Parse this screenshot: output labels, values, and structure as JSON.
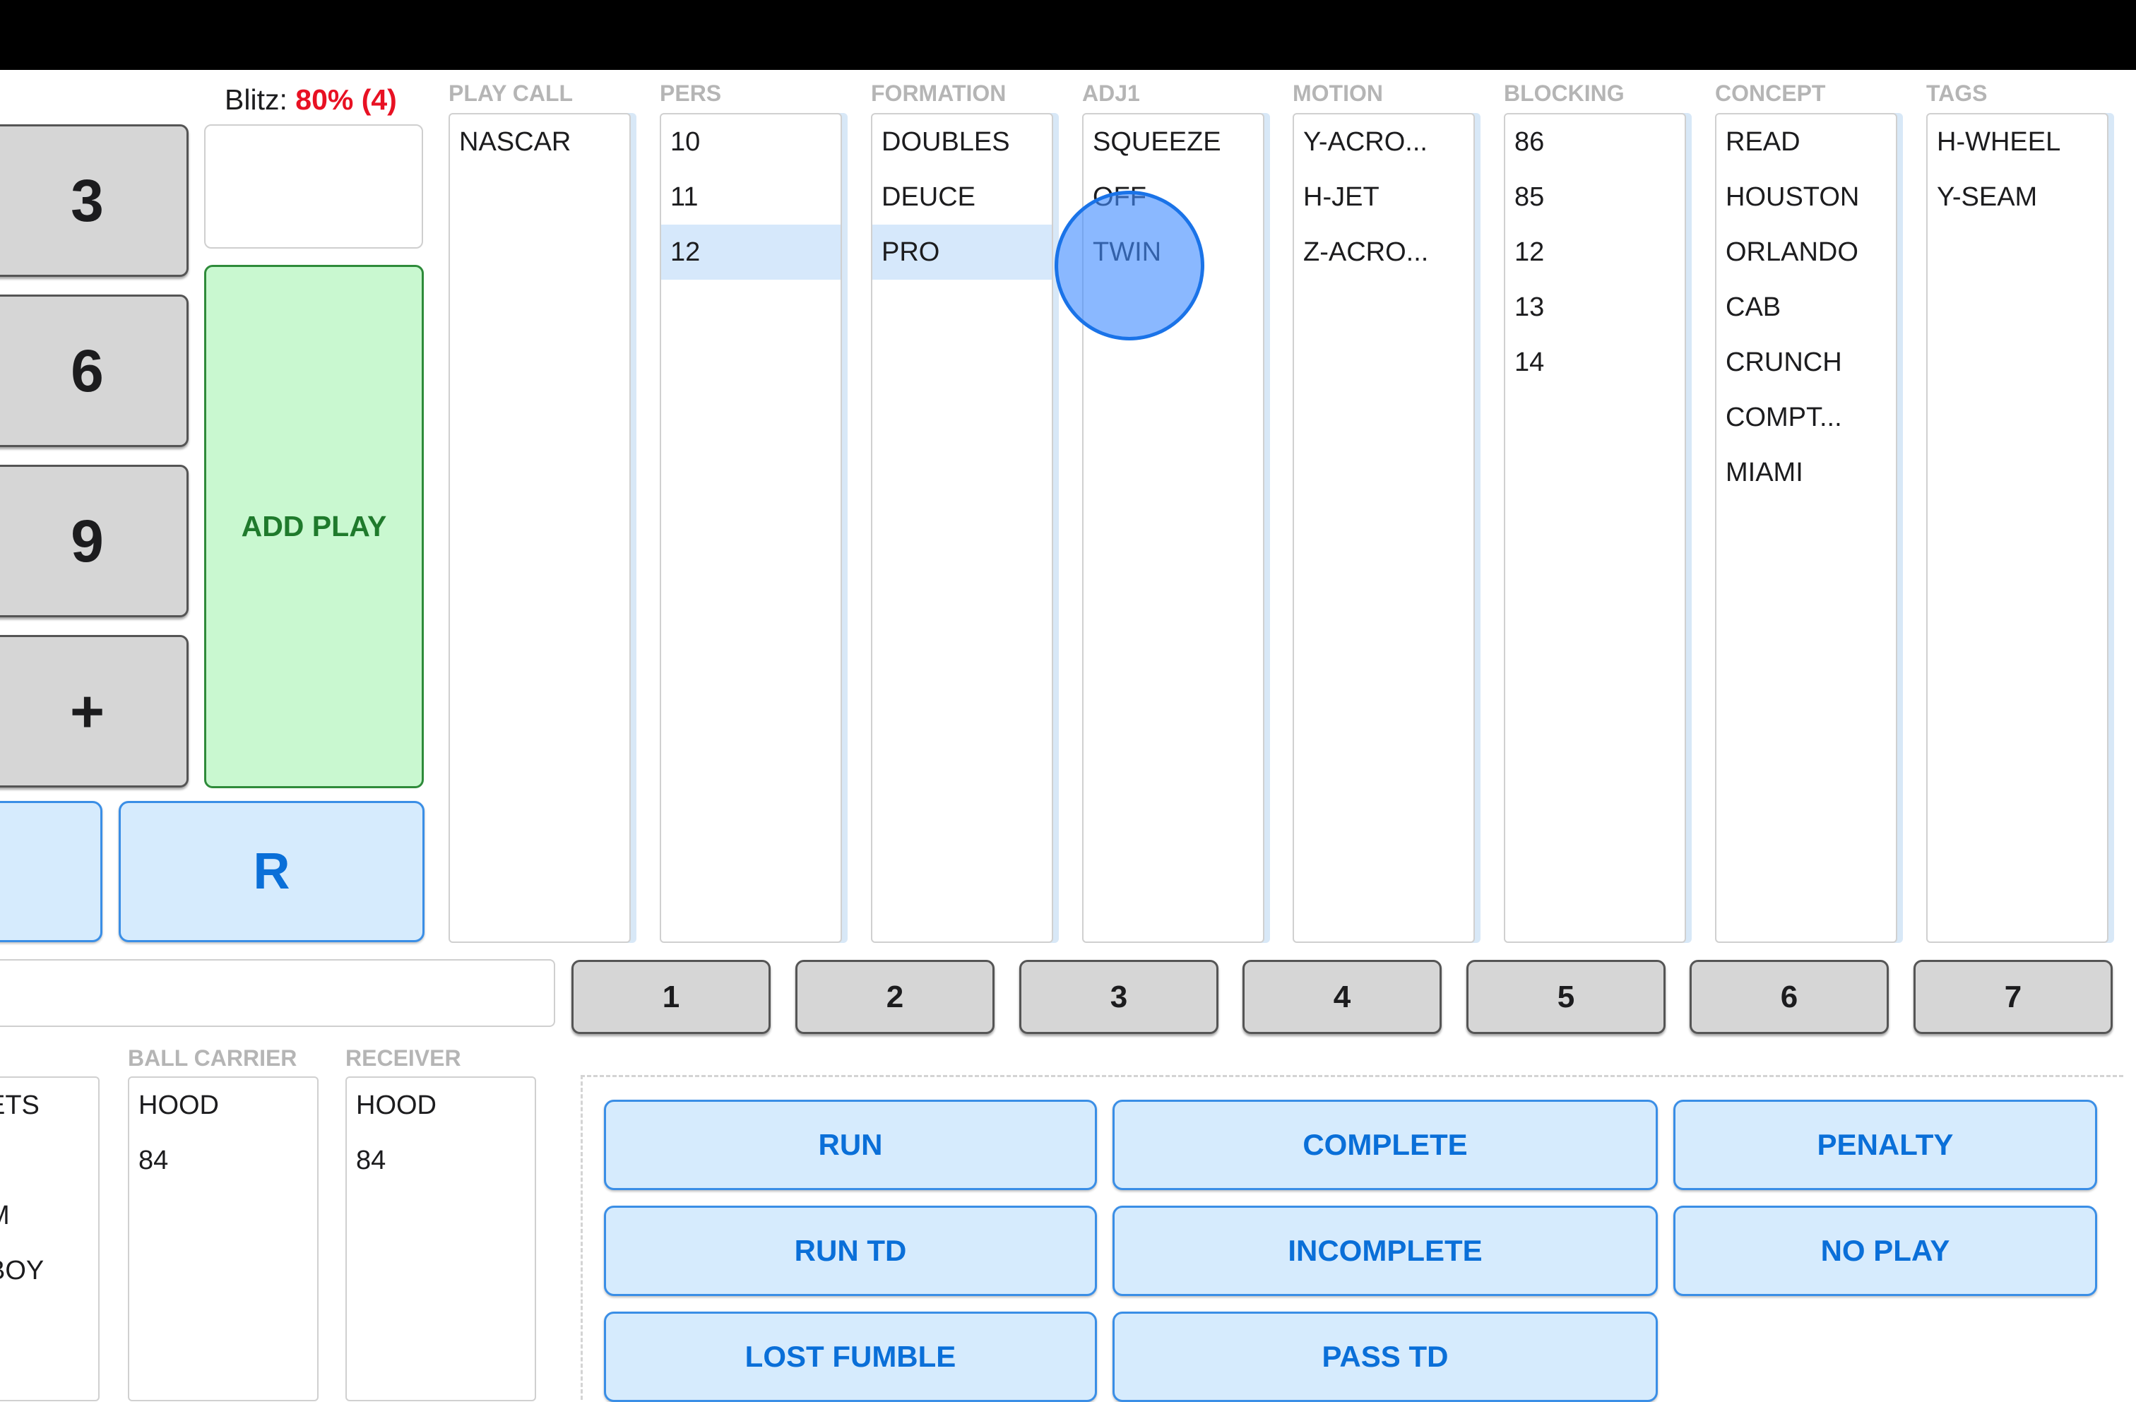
{
  "blitz": {
    "label": "Blitz:",
    "value": "80% (4)"
  },
  "keypad": {
    "keys": [
      "3",
      "6",
      "9",
      "+"
    ],
    "add_play": "ADD PLAY",
    "r_button": "R"
  },
  "columns": [
    {
      "label": "PLAY CALL",
      "items": [
        "NASCAR"
      ],
      "selected": -1
    },
    {
      "label": "PERS",
      "items": [
        "10",
        "11",
        "12"
      ],
      "selected": 2
    },
    {
      "label": "FORMATION",
      "items": [
        "DOUBLES",
        "DEUCE",
        "PRO"
      ],
      "selected": 2
    },
    {
      "label": "ADJ1",
      "items": [
        "SQUEEZE",
        "OFF",
        "TWIN"
      ],
      "selected": -1
    },
    {
      "label": "MOTION",
      "items": [
        "Y-ACRO...",
        "H-JET",
        "Z-ACRO..."
      ],
      "selected": -1
    },
    {
      "label": "BLOCKING",
      "items": [
        "86",
        "85",
        "12",
        "13",
        "14"
      ],
      "selected": -1
    },
    {
      "label": "CONCEPT",
      "items": [
        "READ",
        "HOUSTON",
        "ORLANDO",
        "CAB",
        "CRUNCH",
        "COMPT...",
        "MIAMI"
      ],
      "selected": -1
    },
    {
      "label": "TAGS",
      "items": [
        "H-WHEEL",
        "Y-SEAM"
      ],
      "selected": -1
    }
  ],
  "number_row": [
    "1",
    "2",
    "3",
    "4",
    "5",
    "6",
    "7"
  ],
  "bottom_lists": {
    "partial": {
      "items": [
        "ETS",
        "",
        "M",
        "BOY"
      ]
    },
    "ball_carrier": {
      "label": "BALL CARRIER",
      "items": [
        "HOOD",
        "84"
      ]
    },
    "receiver": {
      "label": "RECEIVER",
      "items": [
        "HOOD",
        "84"
      ]
    }
  },
  "actions": {
    "run": "RUN",
    "complete": "COMPLETE",
    "penalty": "PENALTY",
    "run_td": "RUN TD",
    "incomplete": "INCOMPLETE",
    "no_play": "NO PLAY",
    "lost_fumble": "LOST FUMBLE",
    "pass_td": "PASS TD"
  }
}
